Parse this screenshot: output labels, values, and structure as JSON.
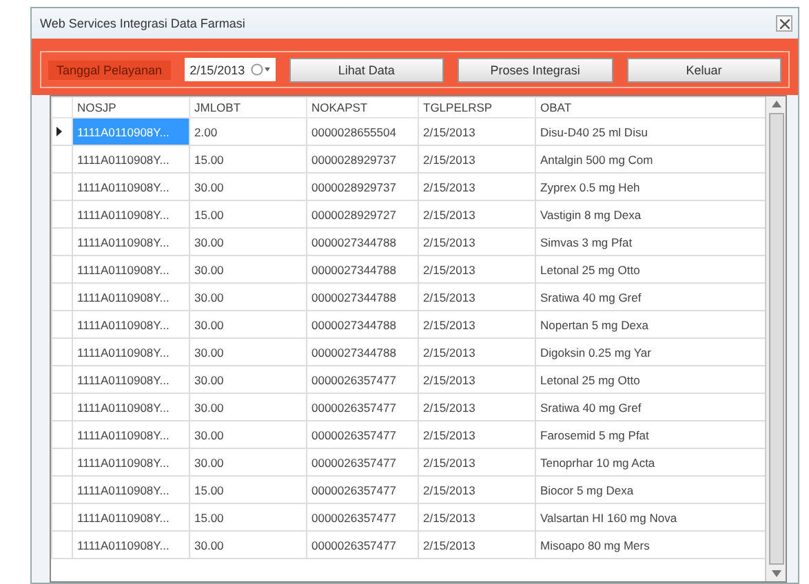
{
  "window": {
    "title": "Web Services Integrasi Data Farmasi"
  },
  "toolbar": {
    "date_label": "Tanggal Pelayanan",
    "date_value": "2/15/2013",
    "buttons": [
      "Lihat Data",
      "Proses Integrasi",
      "Keluar"
    ]
  },
  "table": {
    "columns": [
      "NOSJP",
      "JMLOBT",
      "NOKAPST",
      "TGLPELRSP",
      "OBAT"
    ],
    "rows": [
      {
        "selected": true,
        "cells": [
          "1111A0110908Y...",
          "2.00",
          "0000028655504",
          "2/15/2013",
          "Disu-D40 25 ml Disu"
        ]
      },
      {
        "selected": false,
        "cells": [
          "1111A0110908Y...",
          "15.00",
          "0000028929737",
          "2/15/2013",
          "Antalgin 500 mg Com"
        ]
      },
      {
        "selected": false,
        "cells": [
          "1111A0110908Y...",
          "30.00",
          "0000028929737",
          "2/15/2013",
          "Zyprex 0.5 mg Heh"
        ]
      },
      {
        "selected": false,
        "cells": [
          "1111A0110908Y...",
          "15.00",
          "0000028929727",
          "2/15/2013",
          "Vastigin 8 mg Dexa"
        ]
      },
      {
        "selected": false,
        "cells": [
          "1111A0110908Y...",
          "30.00",
          "0000027344788",
          "2/15/2013",
          "Simvas 3 mg Pfat"
        ]
      },
      {
        "selected": false,
        "cells": [
          "1111A0110908Y...",
          "30.00",
          "0000027344788",
          "2/15/2013",
          "Letonal 25 mg Otto"
        ]
      },
      {
        "selected": false,
        "cells": [
          "1111A0110908Y...",
          "30.00",
          "0000027344788",
          "2/15/2013",
          "Sratiwa 40 mg Gref"
        ]
      },
      {
        "selected": false,
        "cells": [
          "1111A0110908Y...",
          "30.00",
          "0000027344788",
          "2/15/2013",
          "Nopertan 5 mg Dexa"
        ]
      },
      {
        "selected": false,
        "cells": [
          "1111A0110908Y...",
          "30.00",
          "0000027344788",
          "2/15/2013",
          "Digoksin 0.25 mg Yar"
        ]
      },
      {
        "selected": false,
        "cells": [
          "1111A0110908Y...",
          "30.00",
          "0000026357477",
          "2/15/2013",
          "Letonal 25 mg Otto"
        ]
      },
      {
        "selected": false,
        "cells": [
          "1111A0110908Y...",
          "30.00",
          "0000026357477",
          "2/15/2013",
          "Sratiwa 40 mg Gref"
        ]
      },
      {
        "selected": false,
        "cells": [
          "1111A0110908Y...",
          "30.00",
          "0000026357477",
          "2/15/2013",
          "Farosemid 5 mg Pfat"
        ]
      },
      {
        "selected": false,
        "cells": [
          "1111A0110908Y...",
          "30.00",
          "0000026357477",
          "2/15/2013",
          "Tenoprhar 10 mg Acta"
        ]
      },
      {
        "selected": false,
        "cells": [
          "1111A0110908Y...",
          "15.00",
          "0000026357477",
          "2/15/2013",
          "Biocor 5 mg Dexa"
        ]
      },
      {
        "selected": false,
        "cells": [
          "1111A0110908Y...",
          "15.00",
          "0000026357477",
          "2/15/2013",
          "Valsartan HI 160 mg Nova"
        ]
      },
      {
        "selected": false,
        "cells": [
          "1111A0110908Y...",
          "30.00",
          "0000026357477",
          "2/15/2013",
          "Misoapo 80 mg Mers"
        ]
      }
    ]
  }
}
